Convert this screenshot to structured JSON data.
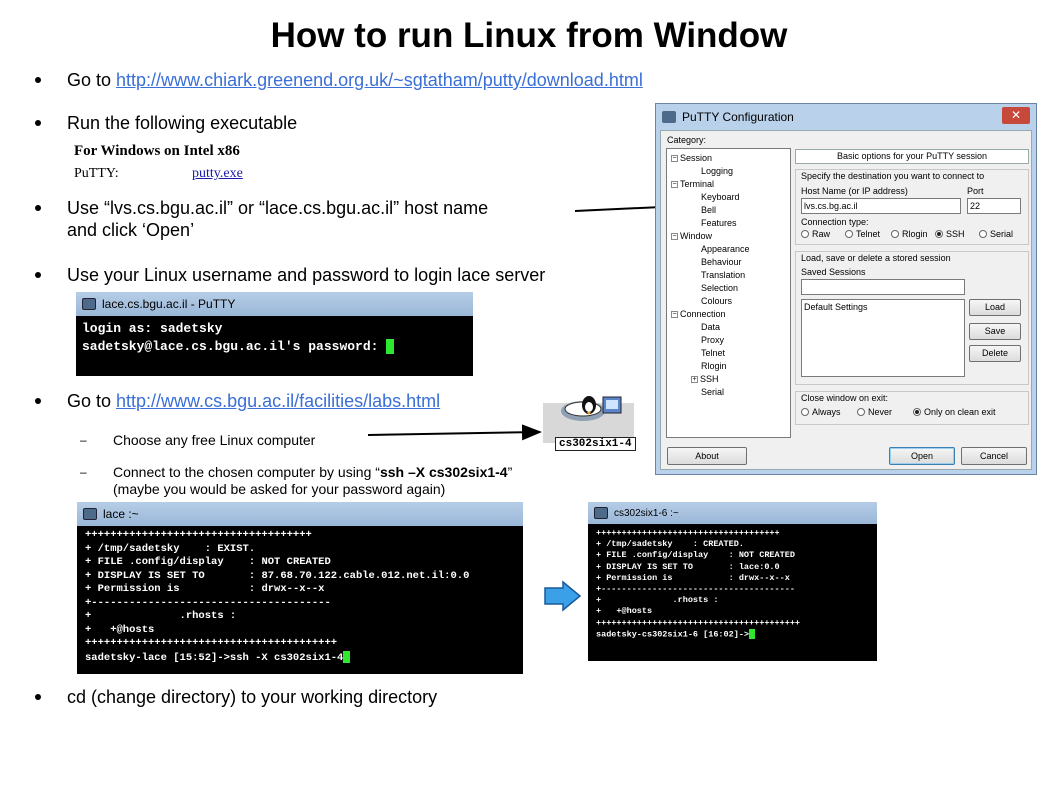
{
  "title": "How to run Linux from Window",
  "bullets": {
    "b1_prefix": "Go to ",
    "b1_link": "http://www.chiark.greenend.org.uk/~sgtatham/putty/download.html",
    "b2": "Run the following executable",
    "b3_line1": "Use “lvs.cs.bgu.ac.il” or “lace.cs.bgu.ac.il” host name",
    "b3_line2": "and click ‘Open’",
    "b4": "Use your Linux username and password to login lace server",
    "b5_prefix": "Go to ",
    "b5_link": "http://www.cs.bgu.ac.il/facilities/labs.html",
    "b6": "cd (change directory) to your working directory"
  },
  "subbullets": {
    "s1": "Choose any free Linux computer",
    "s2_prefix": "Connect to the chosen computer by using “",
    "s2_cmd": "ssh –X cs302six1-4",
    "s2_suffix": "”",
    "s2_line2": "(maybe you would be asked for your password again)"
  },
  "download": {
    "heading": "For Windows on Intel x86",
    "label": "PuTTY:",
    "file": "putty.exe"
  },
  "login_terminal": {
    "title": "lace.cs.bgu.ac.il - PuTTY",
    "line1": "login as: sadetsky",
    "line2": "sadetsky@lace.cs.bgu.ac.il's password: "
  },
  "lace_terminal": {
    "title": "lace :~",
    "l1": "++++++++++++++++++++++++++++++++++++",
    "l2": "+ /tmp/sadetsky    : EXIST.",
    "l3a": "+ FILE .config/display    : ",
    "l3b": "NOT CREATED",
    "l4a": "+ DISPLAY IS SET TO       : ",
    "l4b": "87.68.70.122.cable.012.net.il:0.0",
    "l5a": "+ Permission is           : ",
    "l5b": "drwx--x--x",
    "l6": "+--------------------------------------",
    "l7": "+              .rhosts :",
    "l8": "+   +@hosts",
    "l9": "++++++++++++++++++++++++++++++++++++++++",
    "l10": "sadetsky-lace [15:52]->ssh -X cs302six1-4"
  },
  "remote_terminal": {
    "title": "cs302six1-6 :~",
    "l1": "++++++++++++++++++++++++++++++++++++",
    "l2": "+ /tmp/sadetsky    : CREATED.",
    "l3a": "+ FILE .config/display    : ",
    "l3b": "NOT CREATED",
    "l4a": "+ DISPLAY IS SET TO       : ",
    "l4b": "lace:0.0",
    "l5a": "+ Permission is           : ",
    "l5b": "drwx--x--x",
    "l6": "+--------------------------------------",
    "l7": "+              .rhosts :",
    "l8": "+   +@hosts",
    "l9": "++++++++++++++++++++++++++++++++++++++++",
    "l10": "sadetsky-cs302six1-6 [16:02]->"
  },
  "lab_label": "cs302six1-4",
  "putty": {
    "title": "PuTTY Configuration",
    "close": "✕",
    "category_label": "Category:",
    "tree": {
      "session": "Session",
      "logging": "Logging",
      "terminal": "Terminal",
      "keyboard": "Keyboard",
      "bell": "Bell",
      "features": "Features",
      "window": "Window",
      "appearance": "Appearance",
      "behaviour": "Behaviour",
      "translation": "Translation",
      "selection": "Selection",
      "colours": "Colours",
      "connection": "Connection",
      "data": "Data",
      "proxy": "Proxy",
      "telnet": "Telnet",
      "rlogin": "Rlogin",
      "ssh": "SSH",
      "serial": "Serial"
    },
    "section_head": "Basic options for your PuTTY session",
    "dest_label": "Specify the destination you want to connect to",
    "host_label": "Host Name (or IP address)",
    "port_label": "Port",
    "host_value": "lvs.cs.bg.ac.il",
    "port_value": "22",
    "conn_type_label": "Connection type:",
    "conn_types": {
      "raw": "Raw",
      "telnet": "Telnet",
      "rlogin": "Rlogin",
      "ssh": "SSH",
      "serial": "Serial"
    },
    "sessions_group": "Load, save or delete a stored session",
    "saved_sessions": "Saved Sessions",
    "default_settings": "Default Settings",
    "load": "Load",
    "save": "Save",
    "delete": "Delete",
    "close_group": "Close window on exit:",
    "exit_opts": {
      "always": "Always",
      "never": "Never",
      "clean": "Only on clean exit"
    },
    "about": "About",
    "open": "Open",
    "cancel": "Cancel"
  },
  "colors": {
    "link": "#3a6fd8",
    "terminal_cursor": "#2ee82e",
    "arrow_fill": "#3aa0e8"
  }
}
